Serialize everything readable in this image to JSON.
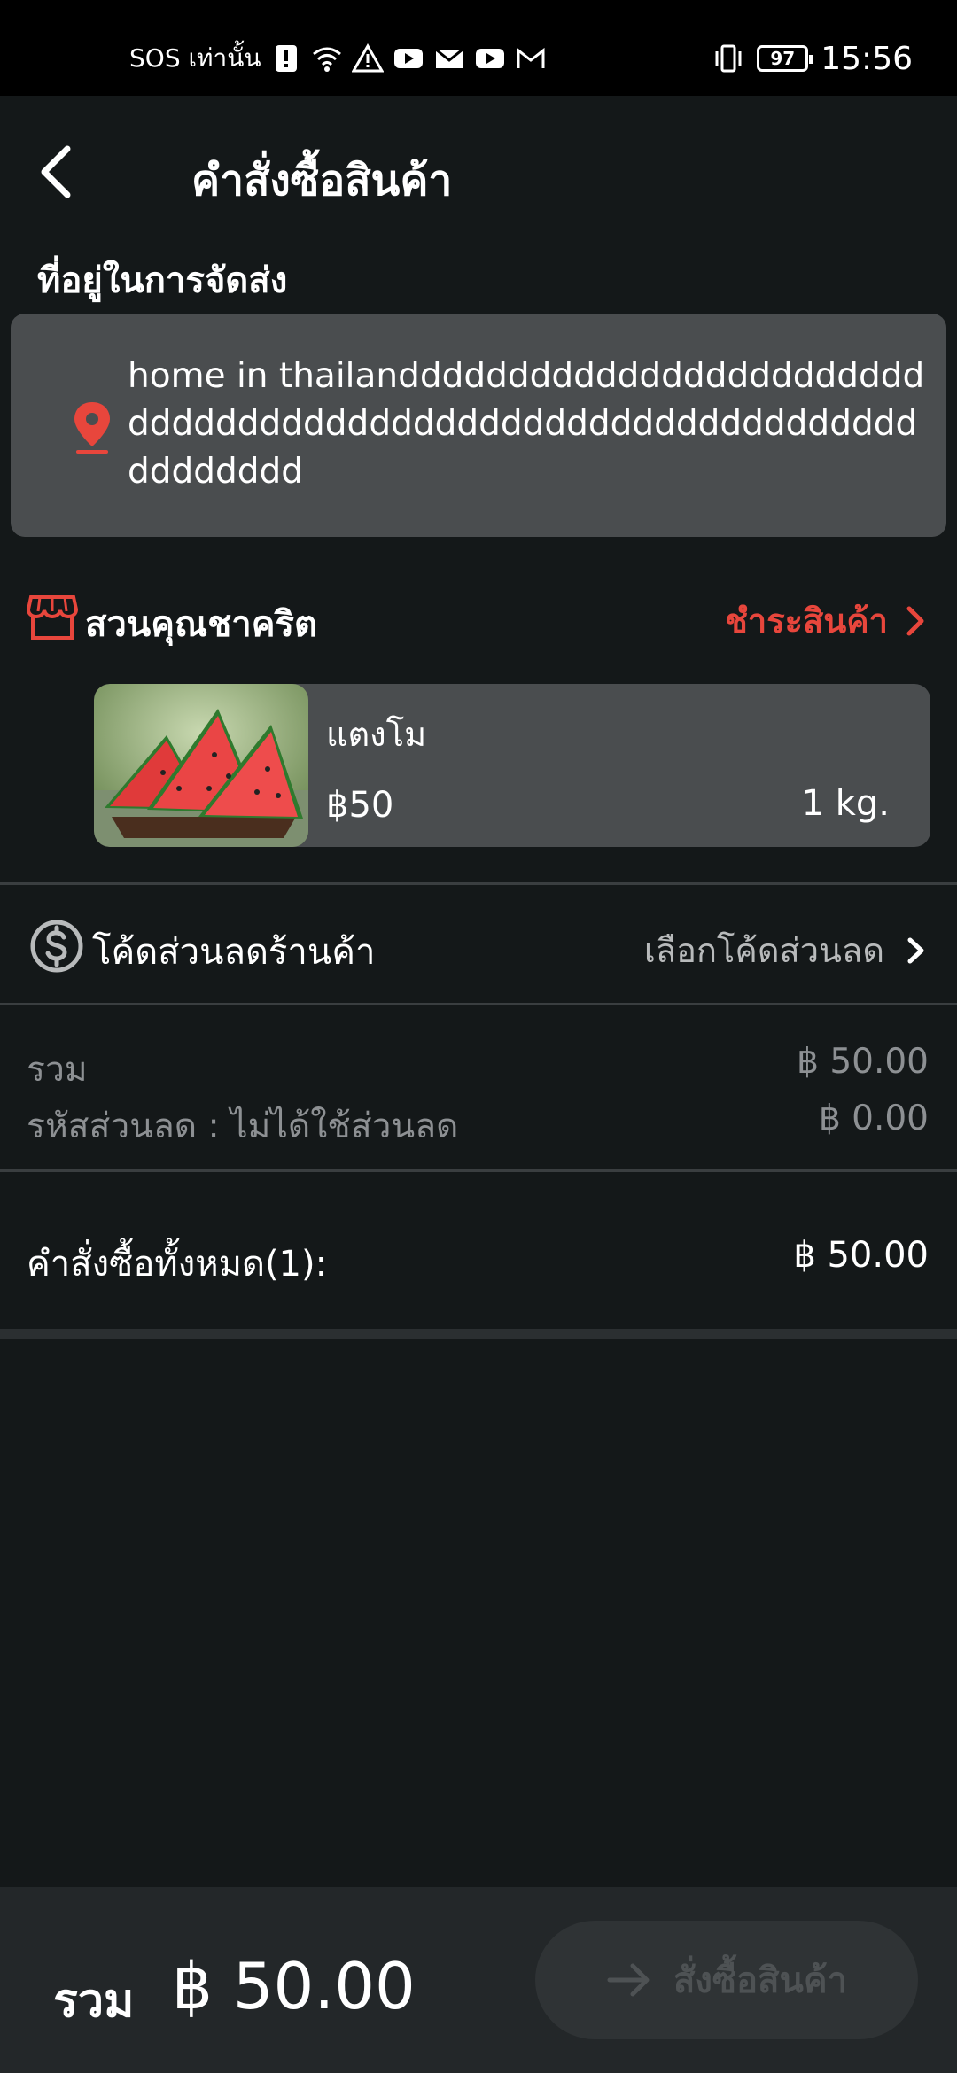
{
  "status_bar": {
    "carrier": "SOS เท่านั้น",
    "battery": "97",
    "time": "15:56"
  },
  "header": {
    "title": "คำสั่งซื้อสินค้า"
  },
  "shipping": {
    "label": "ที่อยู่ในการจัดส่ง",
    "address": "home in thailandddddddddddddddddddddddddddddddddddddddddddddddddddddddddddddddddddd"
  },
  "shop": {
    "name": "สวนคุณชาคริต",
    "pay_label": "ชำระสินค้า"
  },
  "product": {
    "name": "แตงโม",
    "price": "฿50",
    "quantity": "1 kg."
  },
  "coupon": {
    "label": "โค้ดส่วนลดร้านค้า",
    "select_label": "เลือกโค้ดส่วนลด"
  },
  "summary": {
    "subtotal_label": "รวม",
    "subtotal_value": "฿ 50.00",
    "discount_label": "รหัสส่วนลด : ไม่ได้ใช้ส่วนลด",
    "discount_value": "฿ 0.00"
  },
  "order_total": {
    "label": "คำสั่งซื้อทั้งหมด(1):",
    "value": "฿ 50.00"
  },
  "bottom_bar": {
    "total_label": "รวม",
    "total_amount": "฿ 50.00",
    "order_button_label": "สั่งซื้อสินค้า"
  },
  "colors": {
    "background": "#141819",
    "card": "#4a4d4f",
    "accent": "#e8463c",
    "muted_text": "#8d9093",
    "disabled_text": "#4e5254"
  },
  "icons": [
    "back-arrow-icon",
    "location-pin-icon",
    "store-icon",
    "chevron-right-icon",
    "dollar-coin-icon",
    "arrow-right-icon"
  ]
}
